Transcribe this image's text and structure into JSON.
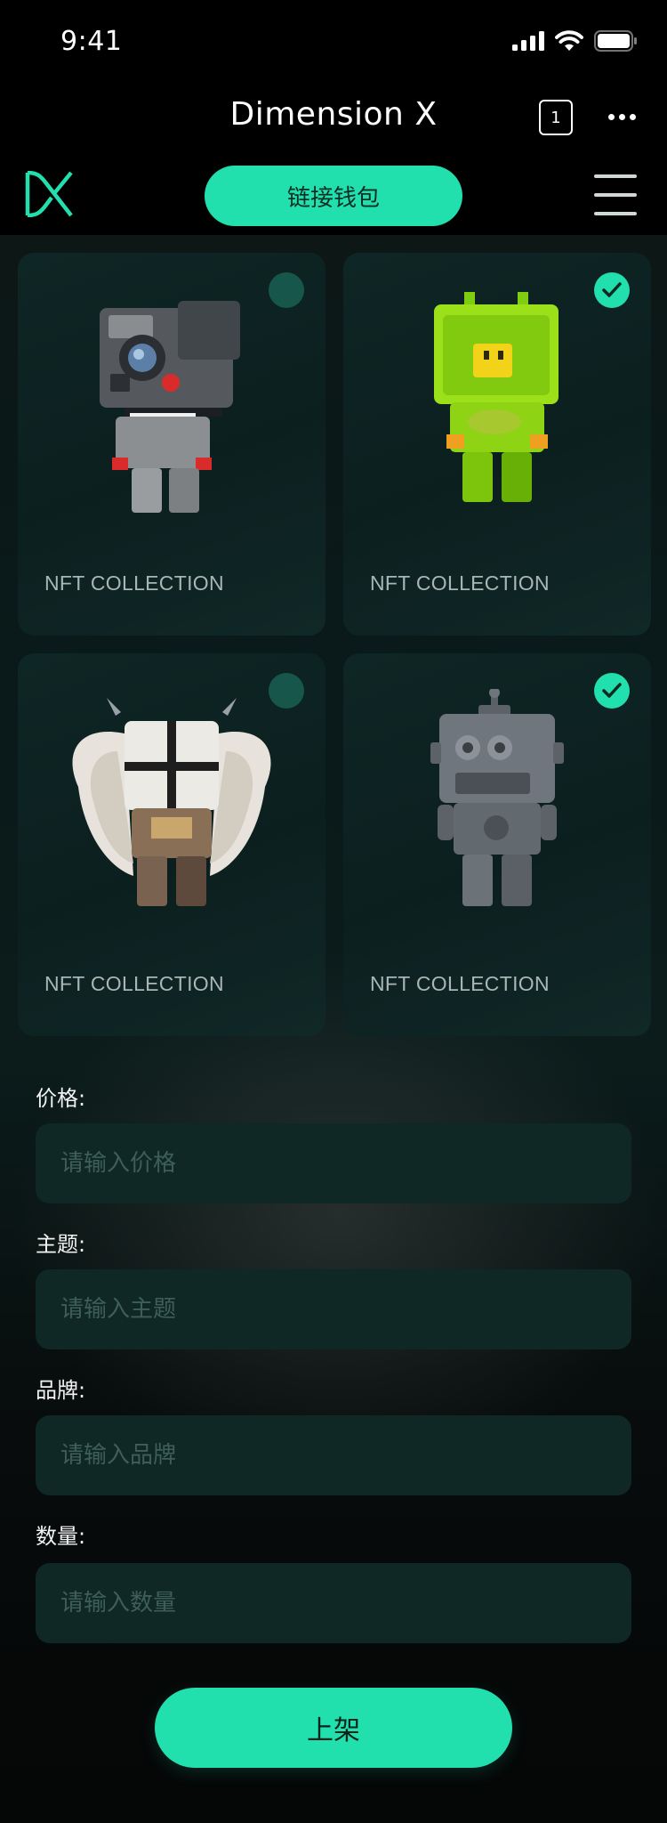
{
  "status_bar": {
    "time": "9:41"
  },
  "nav": {
    "title": "Dimension X",
    "tab_count": "1"
  },
  "header": {
    "connect_label": "链接钱包"
  },
  "cards": [
    {
      "label": "NFT COLLECTION",
      "selected": false,
      "art": "camera-robot"
    },
    {
      "label": "NFT COLLECTION",
      "selected": true,
      "art": "green-cube-robot"
    },
    {
      "label": "NFT COLLECTION",
      "selected": false,
      "art": "winged-robot"
    },
    {
      "label": "NFT COLLECTION",
      "selected": true,
      "art": "metal-robot"
    }
  ],
  "form": {
    "price": {
      "label": "价格:",
      "placeholder": "请输入价格"
    },
    "theme": {
      "label": "主题:",
      "placeholder": "请输入主题"
    },
    "brand": {
      "label": "品牌:",
      "placeholder": "请输入品牌"
    },
    "quantity": {
      "label": "数量:",
      "placeholder": "请输入数量"
    }
  },
  "submit_label": "上架",
  "colors": {
    "accent": "#22dfae",
    "card_bg": "#0e2625",
    "input_bg": "#0f2826"
  }
}
